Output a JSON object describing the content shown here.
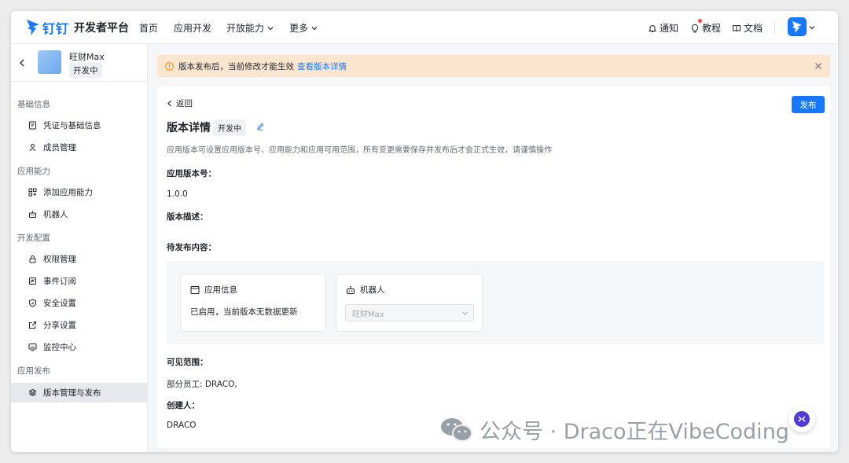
{
  "nav": {
    "brand": "钉钉",
    "platform": "开发者平台",
    "items": [
      "首页",
      "应用开发",
      "开放能力",
      "更多"
    ],
    "notify": "通知",
    "tutorial": "教程",
    "docs": "文档"
  },
  "sidebar": {
    "app_name": "旺财Max",
    "app_status": "开发中",
    "sections": [
      {
        "title": "基础信息",
        "items": [
          "凭证与基础信息",
          "成员管理"
        ]
      },
      {
        "title": "应用能力",
        "items": [
          "添加应用能力",
          "机器人"
        ]
      },
      {
        "title": "开发配置",
        "items": [
          "权限管理",
          "事件订阅",
          "安全设置",
          "分享设置",
          "监控中心"
        ]
      },
      {
        "title": "应用发布",
        "items": [
          "版本管理与发布"
        ]
      }
    ]
  },
  "banner": {
    "text": "版本发布后，当前修改才能生效",
    "link": "查看版本详情"
  },
  "main": {
    "back": "返回",
    "publish": "发布",
    "title": "版本详情",
    "status": "开发中",
    "description": "应用版本可设置应用版本号、应用能力和应用可用范围，所有变更需要保存并发布后才会正式生效，请谨慎操作",
    "version_label": "应用版本号：",
    "version_value": "1.0.0",
    "desc_label": "版本描述：",
    "pending_label": "待发布内容：",
    "card_app_title": "应用信息",
    "card_app_text": "已启用，当前版本无数据更新",
    "card_robot_title": "机器人",
    "card_robot_select": "旺财Max",
    "scope_label": "可见范围：",
    "scope_value": "部分员工: DRACO,",
    "creator_label": "创建人：",
    "creator_value": "DRACO"
  },
  "watermark": "公众号 · Draco正在VibeCoding",
  "colors": {
    "primary": "#1677ff",
    "banner_bg": "#fbe5cf",
    "warning": "#ff8800"
  }
}
